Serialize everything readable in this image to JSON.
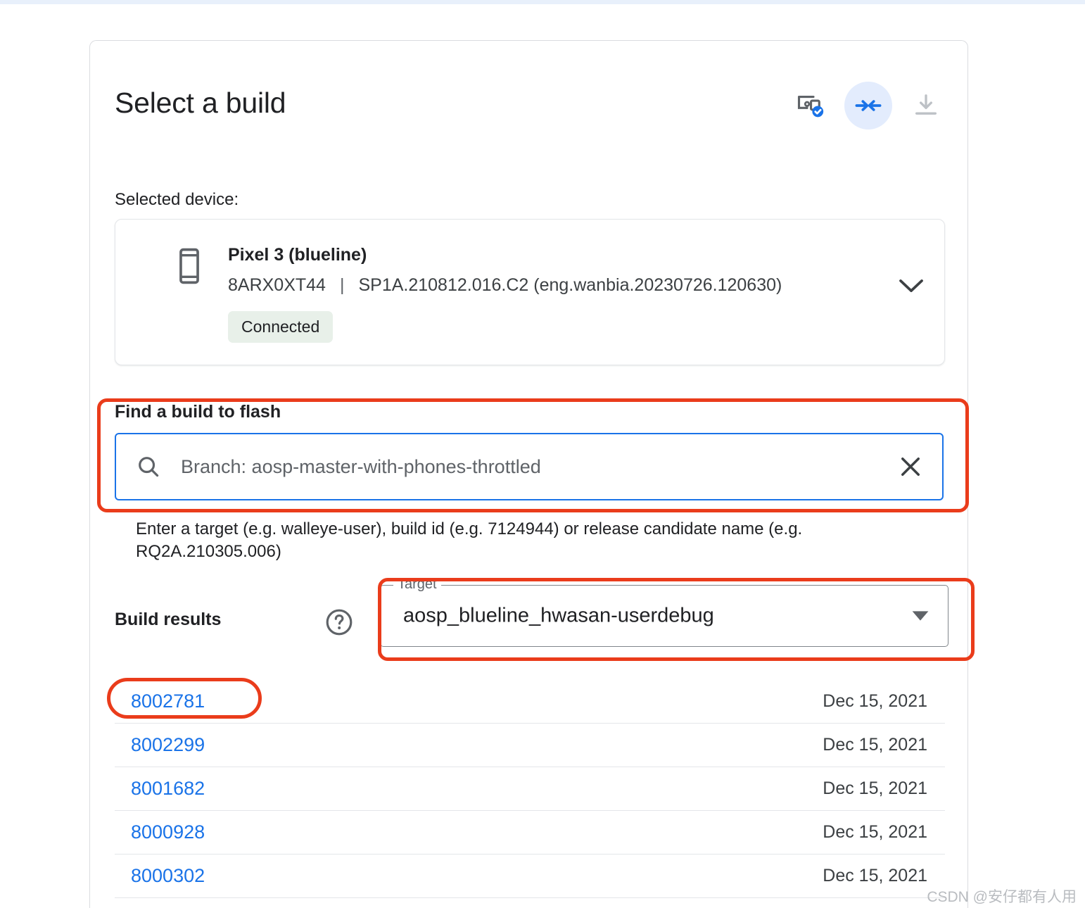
{
  "header": {
    "title": "Select a build",
    "toolbar": [
      {
        "name": "devices-check-icon",
        "label": "Connected devices"
      },
      {
        "name": "compress-arrows-icon",
        "label": "Flash build",
        "active": true
      },
      {
        "name": "download-icon",
        "label": "Download build"
      }
    ]
  },
  "selected_device": {
    "section_label": "Selected device:",
    "icon": "phone-icon",
    "name": "Pixel 3 (blueline)",
    "serial": "8ARX0XT44",
    "separator": "|",
    "build_fingerprint": "SP1A.210812.016.C2 (eng.wanbia.20230726.120630)",
    "status_chip": "Connected",
    "expand_icon": "chevron-down-icon"
  },
  "find_build": {
    "label": "Find a build to flash",
    "search_icon": "search-icon",
    "value": "Branch: aosp-master-with-phones-throttled",
    "placeholder": "Branch: aosp-master-with-phones-throttled",
    "clear_icon": "close-icon",
    "helper_text": "Enter a target (e.g. walleye-user), build id (e.g. 7124944) or release candidate name (e.g. RQ2A.210305.006)"
  },
  "build_results": {
    "label": "Build results",
    "help_icon": "help-circle-icon",
    "target": {
      "floating_label": "Target",
      "selected": "aosp_blueline_hwasan-userdebug",
      "arrow_icon": "dropdown-arrow-icon"
    },
    "rows": [
      {
        "id": "8002781",
        "date": "Dec 15, 2021"
      },
      {
        "id": "8002299",
        "date": "Dec 15, 2021"
      },
      {
        "id": "8001682",
        "date": "Dec 15, 2021"
      },
      {
        "id": "8000928",
        "date": "Dec 15, 2021"
      },
      {
        "id": "8000302",
        "date": "Dec 15, 2021"
      }
    ]
  },
  "annotations": {
    "color": "#ea3c1b",
    "boxes": [
      "find-a-build-to-flash",
      "target-dropdown",
      "build-id-8002781"
    ]
  },
  "watermark": "CSDN @安仔都有人用",
  "colors": {
    "accent_blue": "#1a73e8",
    "annotation_red": "#ea3c1b",
    "chip_green_bg": "#e8f0e9",
    "text_primary": "#202124",
    "text_secondary": "#5f6368"
  }
}
